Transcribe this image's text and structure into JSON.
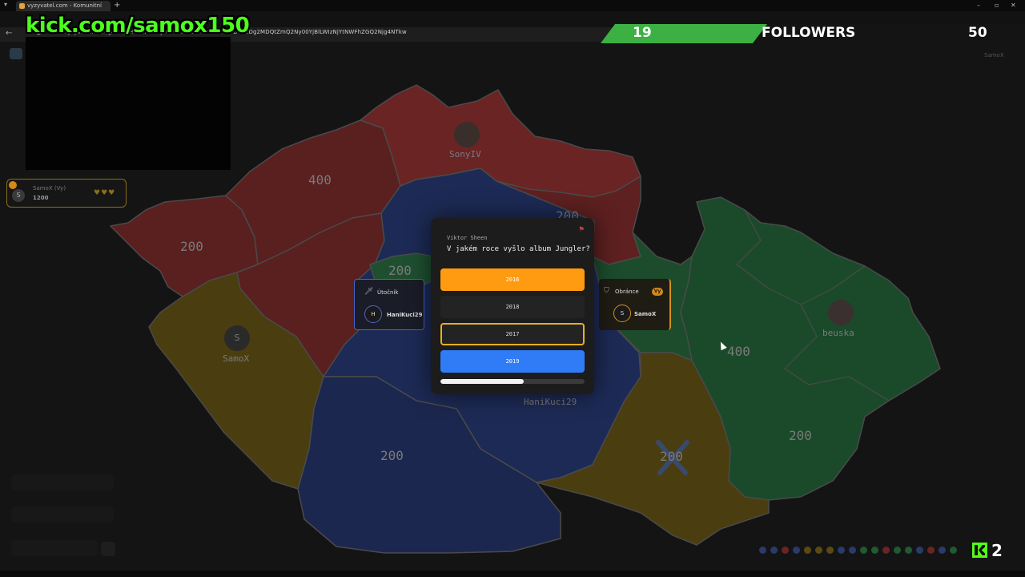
{
  "browser": {
    "tab_title": "vyzyvatel.com - Komunitní",
    "url": "vyzyvatel.com/game/aHR0cHM6Ly9ZmU0ZWMxYzY5YmlfODFkODg2MDQtZmQ2Ny00YjBlLWIzNjYtNWFhZGQ2Njg4NTkw"
  },
  "stream": {
    "kick_channel": "kick.com/samox150",
    "followers_count": "19",
    "followers_label": "FOLLOWERS",
    "followers_goal": "50",
    "viewer_count": "2"
  },
  "sidebar": {
    "player_card": {
      "name": "SamoX (Vy)",
      "score": "1200",
      "initial": "S",
      "hearts": "♥♥♥"
    }
  },
  "map": {
    "region_values": [
      "400",
      "200",
      "200",
      "200",
      "200",
      "400",
      "200",
      "200"
    ],
    "players": [
      {
        "name": "SonyIV",
        "color": "#7a2626"
      },
      {
        "name": "SamoX",
        "color": "#6b5a12",
        "initial": "S"
      },
      {
        "name": "HaniKuci29",
        "color": "#22356b"
      },
      {
        "name": "beuska",
        "color": "#1f5a32"
      }
    ]
  },
  "attacker": {
    "role_label": "Útočník",
    "name": "HaniKuci29",
    "initial": "H"
  },
  "defender": {
    "role_label": "Obránce",
    "you_badge": "Vy",
    "name": "SamoX",
    "initial": "S"
  },
  "question": {
    "author": "Viktor Sheen",
    "text": "V jakém roce vyšlo album Jungler?",
    "answers": [
      "2016",
      "2018",
      "2017",
      "2019"
    ],
    "timer_progress": 0.58
  },
  "colors": {
    "red": "#7a2626",
    "blue": "#22356b",
    "green": "#1f5a32",
    "yellow": "#6b5a12",
    "orange": "#ff9b10",
    "accent_blue": "#2f7cf6",
    "kick_green": "#53fc18"
  }
}
